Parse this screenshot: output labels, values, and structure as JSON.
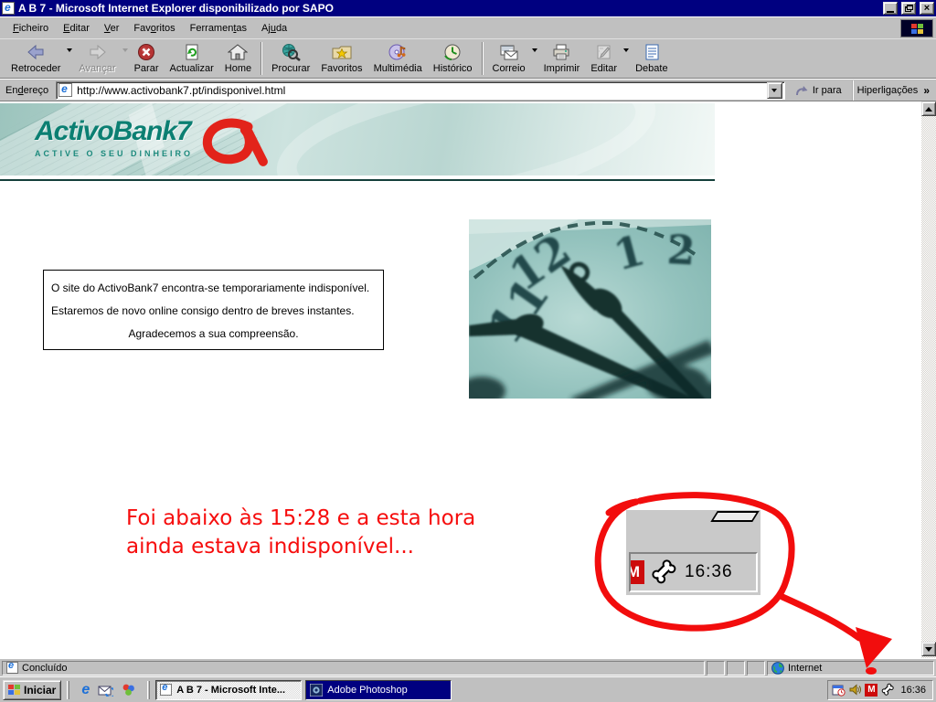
{
  "window": {
    "title": "A B 7 - Microsoft Internet Explorer disponibilizado por SAPO"
  },
  "menu": {
    "items": [
      {
        "pre": "",
        "key": "F",
        "post": "icheiro"
      },
      {
        "pre": "",
        "key": "E",
        "post": "ditar"
      },
      {
        "pre": "",
        "key": "V",
        "post": "er"
      },
      {
        "pre": "Fav",
        "key": "o",
        "post": "ritos"
      },
      {
        "pre": "Ferramen",
        "key": "t",
        "post": "as"
      },
      {
        "pre": "Aj",
        "key": "u",
        "post": "da"
      }
    ]
  },
  "toolbar": {
    "buttons": [
      {
        "label": "Retroceder"
      },
      {
        "label": "Avançar"
      },
      {
        "label": "Parar"
      },
      {
        "label": "Actualizar"
      },
      {
        "label": "Home"
      },
      {
        "label": "Procurar"
      },
      {
        "label": "Favoritos"
      },
      {
        "label": "Multimédia"
      },
      {
        "label": "Histórico"
      },
      {
        "label": "Correio"
      },
      {
        "label": "Imprimir"
      },
      {
        "label": "Editar"
      },
      {
        "label": "Debate"
      }
    ]
  },
  "address": {
    "label_pre": "En",
    "label_key": "d",
    "label_post": "ereço",
    "url": "http://www.activobank7.pt/indisponivel.html",
    "go": "Ir para",
    "links": "Hiperligações",
    "chevron": "»"
  },
  "page": {
    "banner": {
      "brand": "ActivoBank7",
      "tagline": "ACTIVE O SEU DINHEIRO"
    },
    "notice": {
      "line1": "O site do ActivoBank7 encontra-se temporariamente indisponível.",
      "line2": "Estaremos de novo online consigo dentro de breves instantes.",
      "line3": "Agradecemos a sua compreensão."
    },
    "annotation": {
      "line1": "Foi abaixo às 15:28 e a esta hora",
      "line2": "ainda estava indisponível..."
    },
    "clip": {
      "time": "16:36",
      "m_letter": "M"
    }
  },
  "status": {
    "message": "Concluído",
    "zone": "Internet"
  },
  "taskbar": {
    "start": "Iniciar",
    "task1": "A B 7 - Microsoft Inte...",
    "task2": "Adobe Photoshop",
    "time": "16:36"
  },
  "colors": {
    "accent_red": "#f20d0d",
    "brand_teal": "#0b7f72",
    "logo_red": "#e2231a",
    "title_blue": "#000080"
  }
}
